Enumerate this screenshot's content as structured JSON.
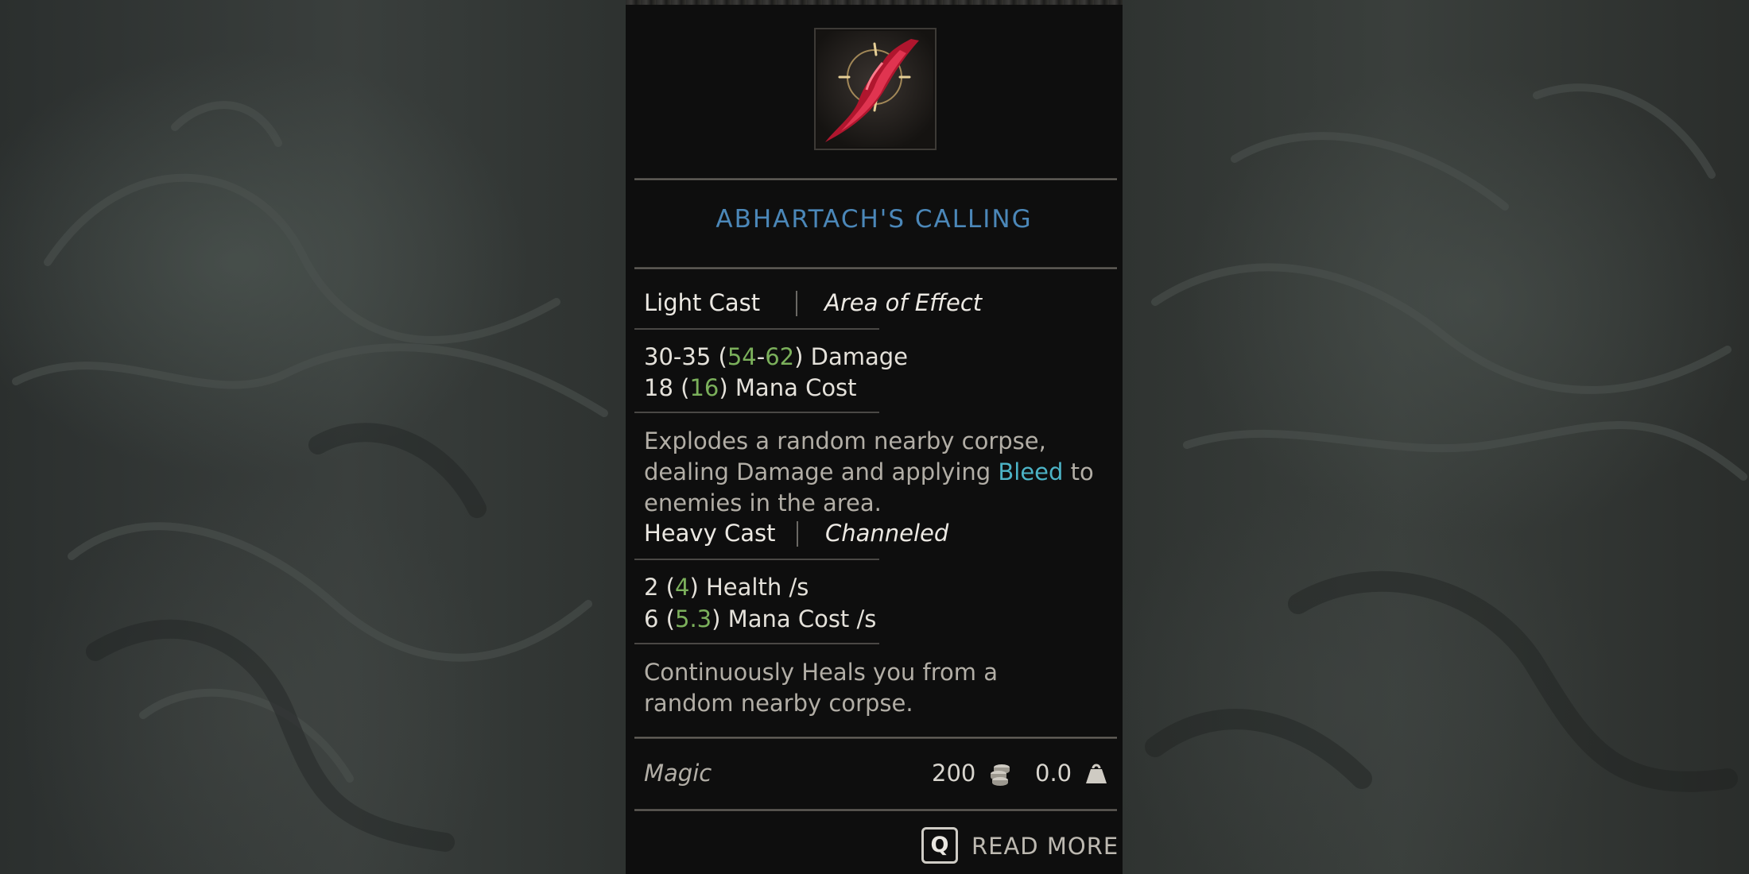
{
  "spell": {
    "icon": "abhartachs-calling-spell-icon",
    "title": "ABHARTACH'S CALLING"
  },
  "light_cast": {
    "label": "Light Cast",
    "tag": "Area of Effect",
    "damage_base": "30-35",
    "damage_upgraded_low": "54",
    "damage_upgraded_high": "62",
    "damage_label": "Damage",
    "mana_base": "18",
    "mana_upgraded": "16",
    "mana_label": "Mana Cost",
    "desc_part1": "Explodes a random nearby corpse, dealing Damage and applying ",
    "desc_keyword": "Bleed",
    "desc_part2": " to enemies in the area."
  },
  "heavy_cast": {
    "label": "Heavy Cast",
    "tag": "Channeled",
    "health_base": "2",
    "health_upgraded": "4",
    "health_label": "Health /s",
    "mana_base": "6",
    "mana_upgraded": "5.3",
    "mana_label": "Mana Cost /s",
    "description": "Continuously Heals you from a random nearby corpse."
  },
  "footer": {
    "type": "Magic",
    "price": "200",
    "price_icon": "coins-icon",
    "weight": "0.0",
    "weight_icon": "weight-icon"
  },
  "read_more": {
    "key": "Q",
    "label": "READ MORE"
  },
  "colors": {
    "title": "#4b87b8",
    "upgraded_value": "#7bb05b",
    "keyword": "#4cb3c6",
    "panel_bg": "#0e0e0e"
  }
}
